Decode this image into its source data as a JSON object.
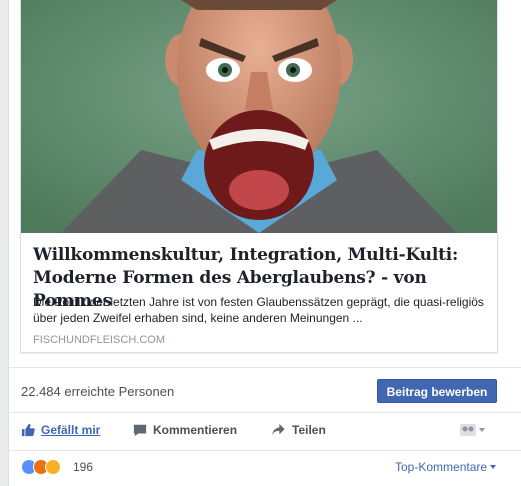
{
  "post": {
    "link_card": {
      "image_alt": "Mann schreit",
      "title": "Willkommenskultur, Integration, Multi-Kulti: Moderne Formen des Aberglaubens? - von Pommes",
      "description": "Die Politik der letzten Jahre ist von festen Glaubenssätzen geprägt, die quasi-religiös über jeden Zweifel erhaben sind, keine anderen Meinungen ...",
      "domain": "FISCHUNDFLEISCH.COM"
    },
    "reach": {
      "text": "22.484 erreichte Personen",
      "promote_label": "Beitrag bewerben"
    },
    "actions": {
      "like_label": "Gefällt mir",
      "comment_label": "Kommentieren",
      "share_label": "Teilen"
    },
    "reactions": {
      "count": "196",
      "top_comments_label": "Top-Kommentare"
    }
  },
  "colors": {
    "brand": "#4267b2",
    "text": "#1d2129",
    "muted": "#90949c",
    "background": "#e9ebee"
  }
}
